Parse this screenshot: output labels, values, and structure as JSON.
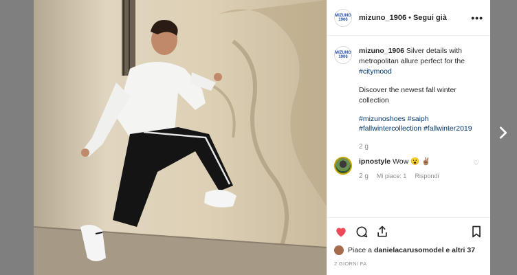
{
  "post": {
    "account": "mizuno_1906",
    "avatar_text": "MIZUNO 1906",
    "separator": "•",
    "follow_label": "Segui già",
    "more_label": "•••",
    "caption": {
      "username": "mizuno_1906",
      "text": "Silver details with metropolitan allure perfect for the",
      "tag1": "#citymood",
      "line2": "Discover the newest fall winter collection",
      "tag2": "#mizunoshoes",
      "tag3": "#saiph",
      "tag4": "#fallwintercollection",
      "tag5": "#fallwinter2019",
      "time": "2 g"
    },
    "reply": {
      "username": "ipnostyle",
      "text": "Wow 😮 ✌🏽",
      "time": "2 g",
      "likes": "Mi piace: 1",
      "reply_label": "Rispondi",
      "like_icon": "♡"
    },
    "likes_line": {
      "prefix": "Piace a",
      "user": "danielacarusomodel",
      "suffix": "e altri 37"
    },
    "posted": "2 GIORNI FA"
  },
  "colors": {
    "liked": "#ed4956",
    "hashtag": "#00376b",
    "muted": "#8e8e8e"
  },
  "icons": [
    "heart-icon",
    "comment-icon",
    "share-icon",
    "bookmark-icon",
    "chevron-right-icon",
    "more-icon"
  ]
}
